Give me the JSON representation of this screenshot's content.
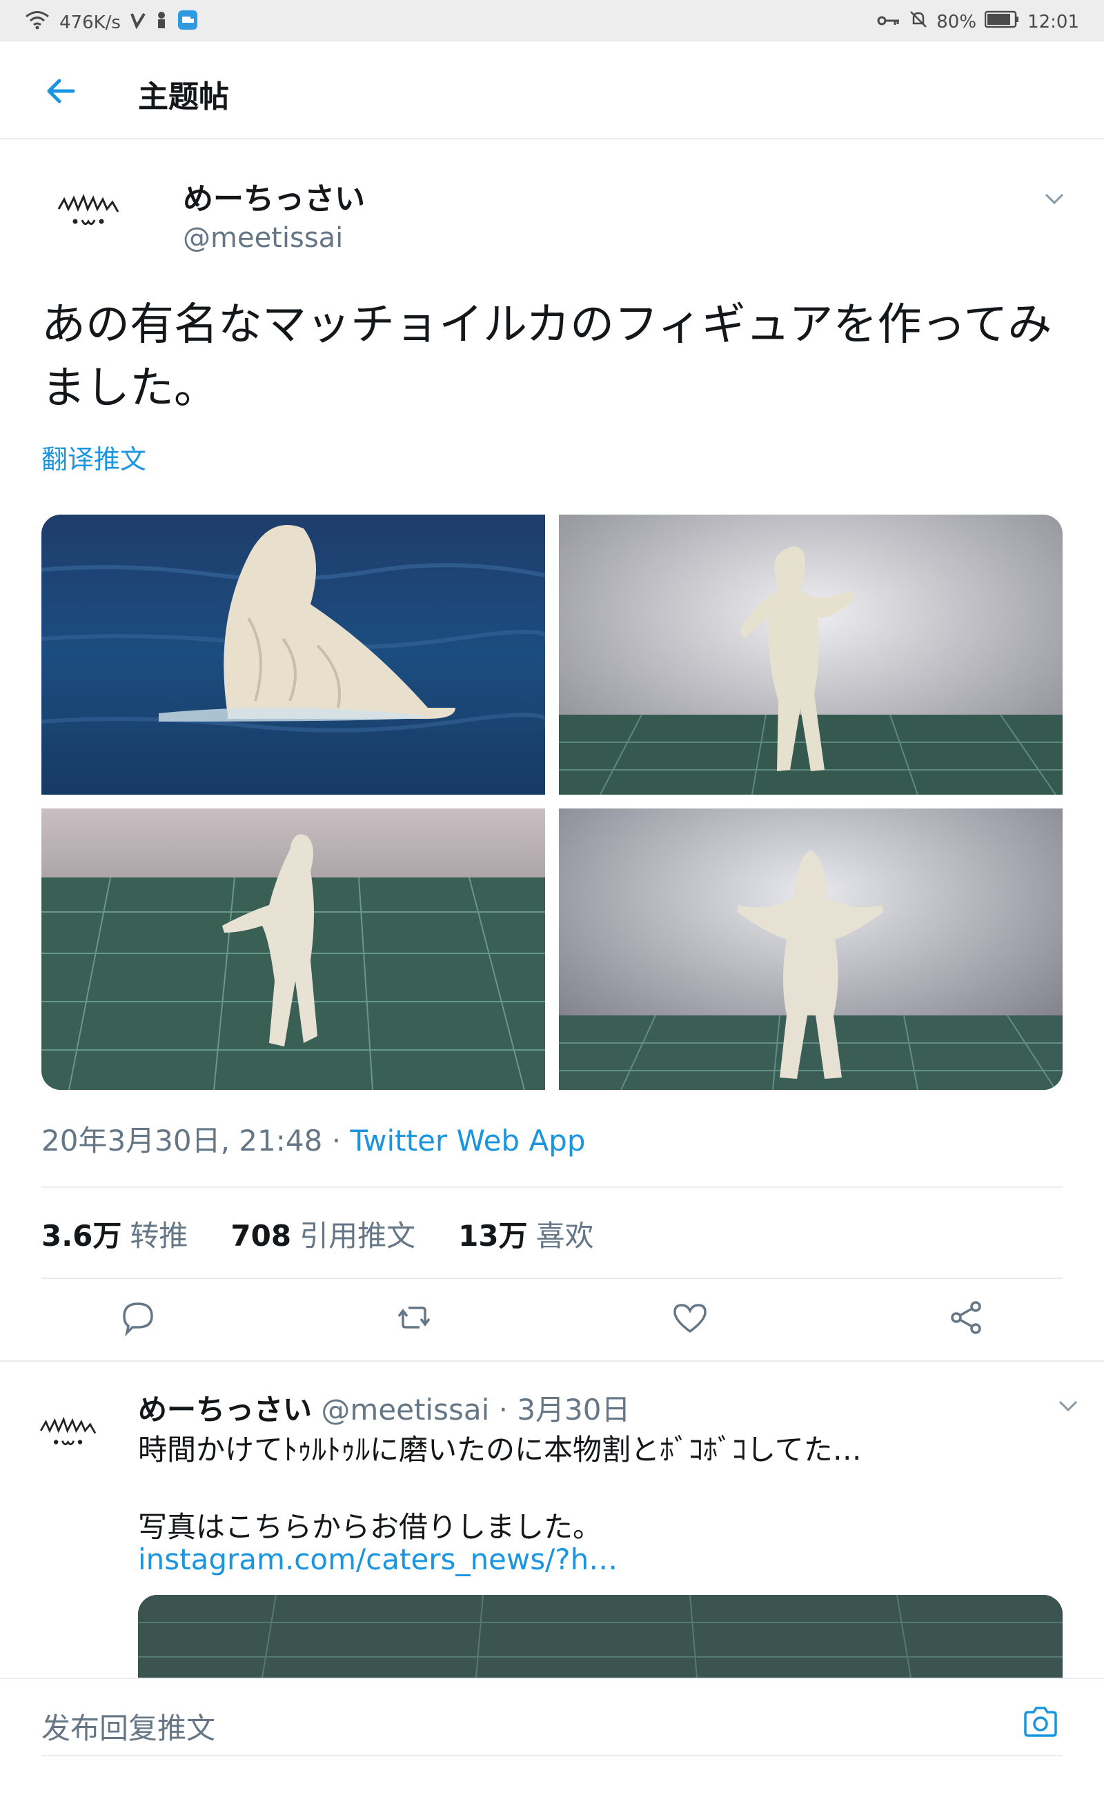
{
  "status_bar": {
    "speed": "476K/s",
    "battery": "80%",
    "time": "12:01"
  },
  "app_bar": {
    "title": "主题帖"
  },
  "tweet": {
    "display_name": "めーちっさい",
    "handle": "@meetissai",
    "text": "あの有名なマッチョイルカのフィギュアを作ってみました。",
    "translate": "翻译推文",
    "timestamp": "20年3月30日, 21:48 · ",
    "source": "Twitter Web App",
    "stats": {
      "retweets_count": "3.6万",
      "retweets_label": "转推",
      "quotes_count": "708",
      "quotes_label": "引用推文",
      "likes_count": "13万",
      "likes_label": "喜欢"
    }
  },
  "reply": {
    "display_name": "めーちっさい",
    "handle_date": " @meetissai · 3月30日",
    "line1": "時間かけてﾄｩﾙﾄｩﾙに磨いたのに本物割とﾎﾞｺﾎﾞｺしてた…",
    "line2": "写真はこちらからお借りしました。",
    "link": "instagram.com/caters_news/?h…"
  },
  "composer": {
    "placeholder": "发布回复推文"
  },
  "colors": {
    "accent": "#1b95e0",
    "secondary_text": "#657786",
    "divider": "#e6ecf0"
  }
}
